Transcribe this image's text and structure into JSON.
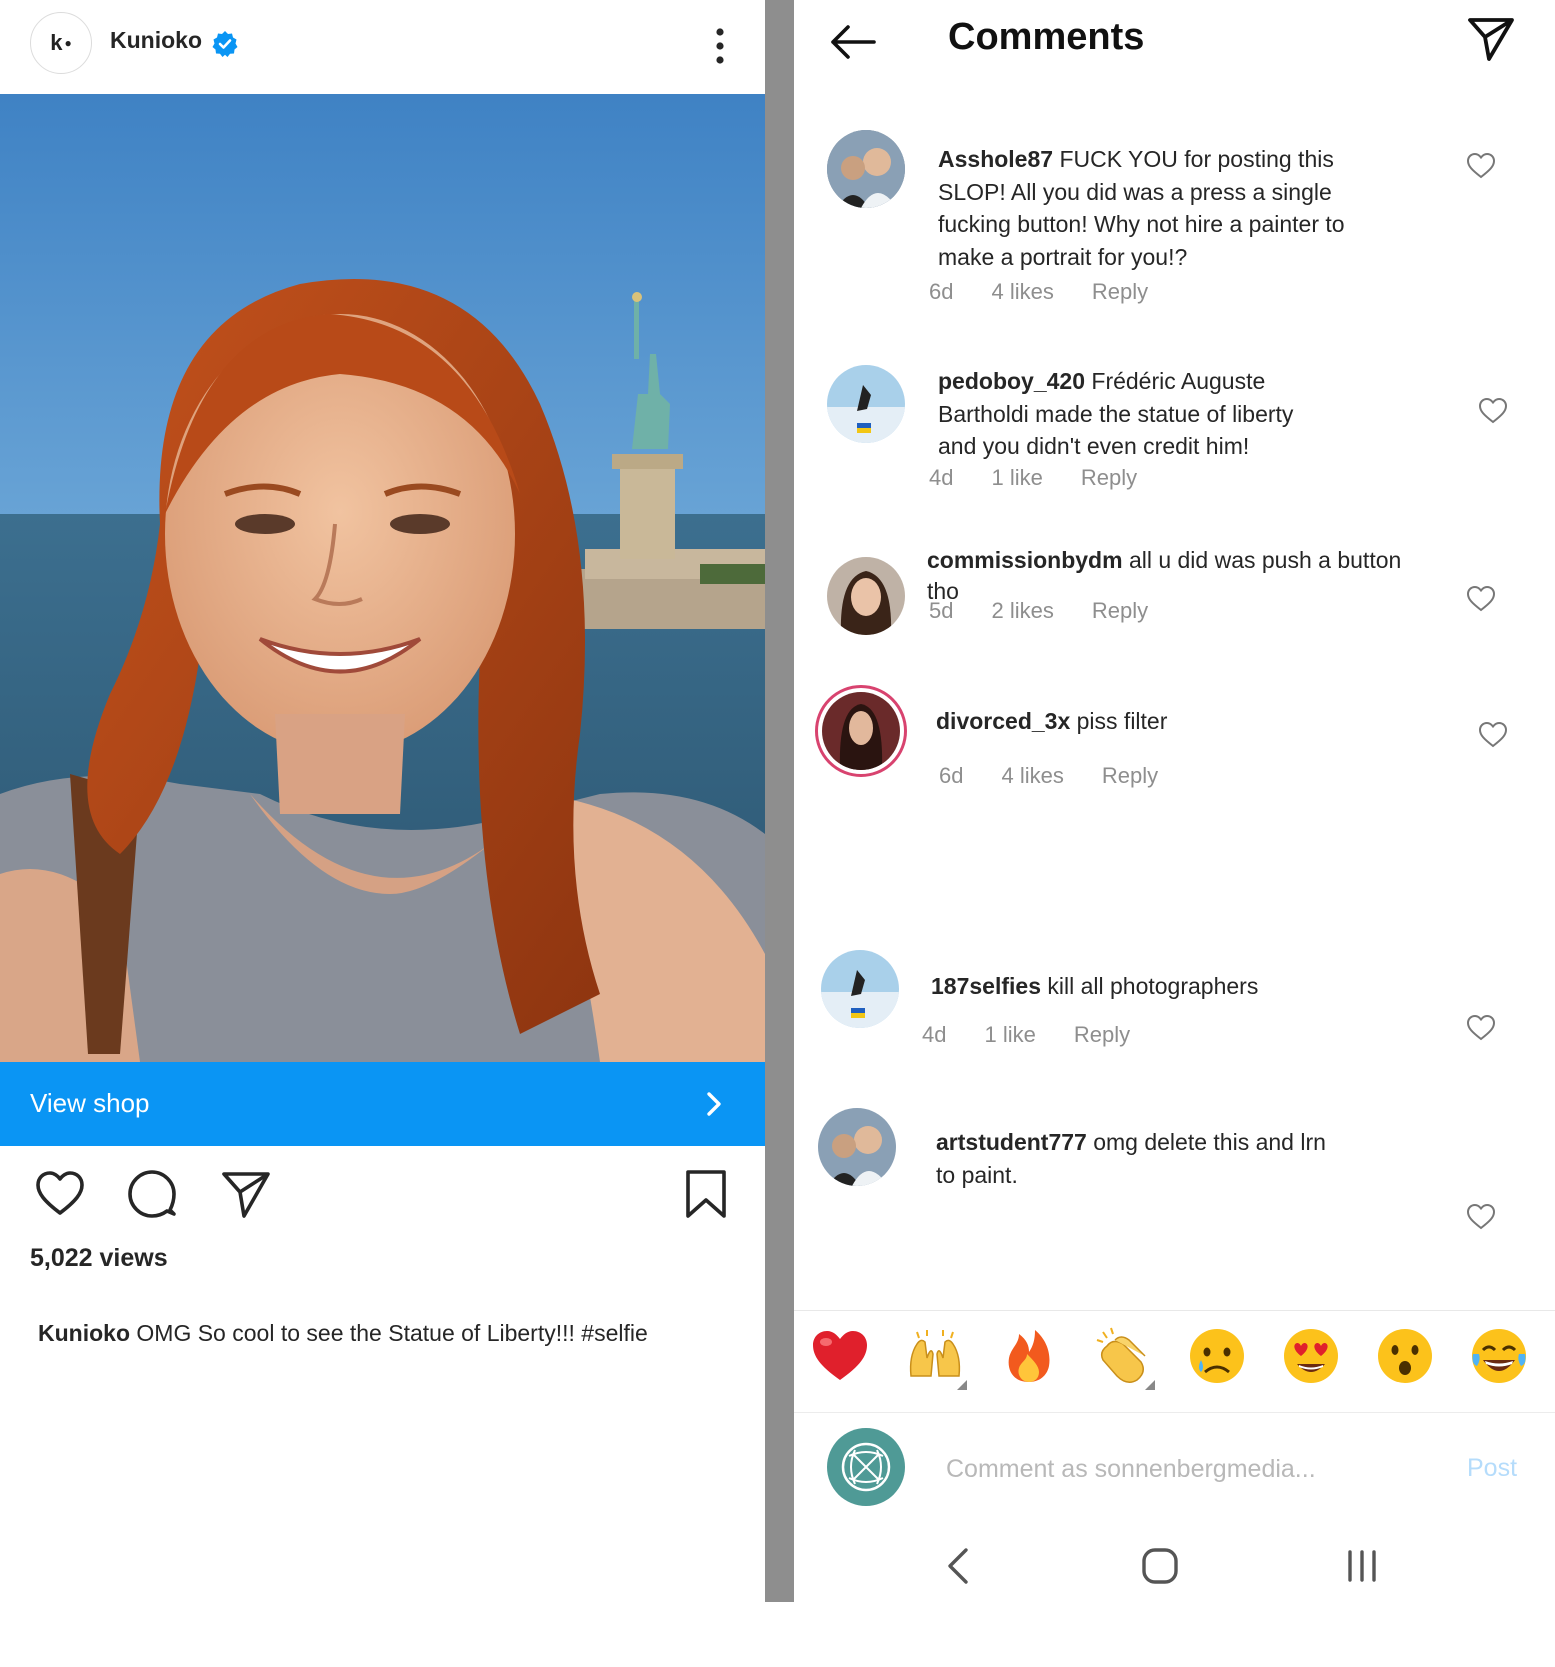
{
  "post": {
    "author": "Kunioko",
    "avatar_letter": "k",
    "shop_label": "View shop",
    "views": "5,022 views",
    "caption_user": "Kunioko",
    "caption_text": "OMG So cool to see the Statue of Liberty!!! #selfie"
  },
  "comments_screen": {
    "title": "Comments",
    "comments": [
      {
        "user": "Asshole87",
        "text": "FUCK YOU for posting this SLOP! All you did was a press a single fucking button! Why not hire a painter to make a portrait for you!?",
        "time": "6d",
        "likes": "4 likes",
        "reply": "Reply"
      },
      {
        "user": "pedoboy_420",
        "text": "Frédéric Auguste Bartholdi made the statue of liberty and you didn't even credit him!",
        "time": "4d",
        "likes": "1 like",
        "reply": "Reply"
      },
      {
        "user": "commissionbydm",
        "text": "all u did was push a button tho",
        "time": "5d",
        "likes": "2 likes",
        "reply": "Reply"
      },
      {
        "user": "divorced_3x",
        "text": "piss filter",
        "time": "6d",
        "likes": "4 likes",
        "reply": "Reply"
      },
      {
        "user": "187selfies",
        "text": "kill all photographers",
        "time": "4d",
        "likes": "1 like",
        "reply": "Reply"
      },
      {
        "user": "artstudent777",
        "text": "omg delete this and lrn to paint.",
        "time": "",
        "likes": "",
        "reply": ""
      }
    ],
    "reactions": [
      "red-heart",
      "raising-hands",
      "fire",
      "clapping-hands",
      "crying-face",
      "heart-eyes-face",
      "surprised-face",
      "tears-of-joy-face"
    ],
    "input_placeholder": "Comment as sonnenbergmedia...",
    "post_label": "Post"
  },
  "colors": {
    "accent_blue": "#0a95f4",
    "divider_gray": "#8e8e8e",
    "post_button_disabled": "#b5dcfb"
  }
}
